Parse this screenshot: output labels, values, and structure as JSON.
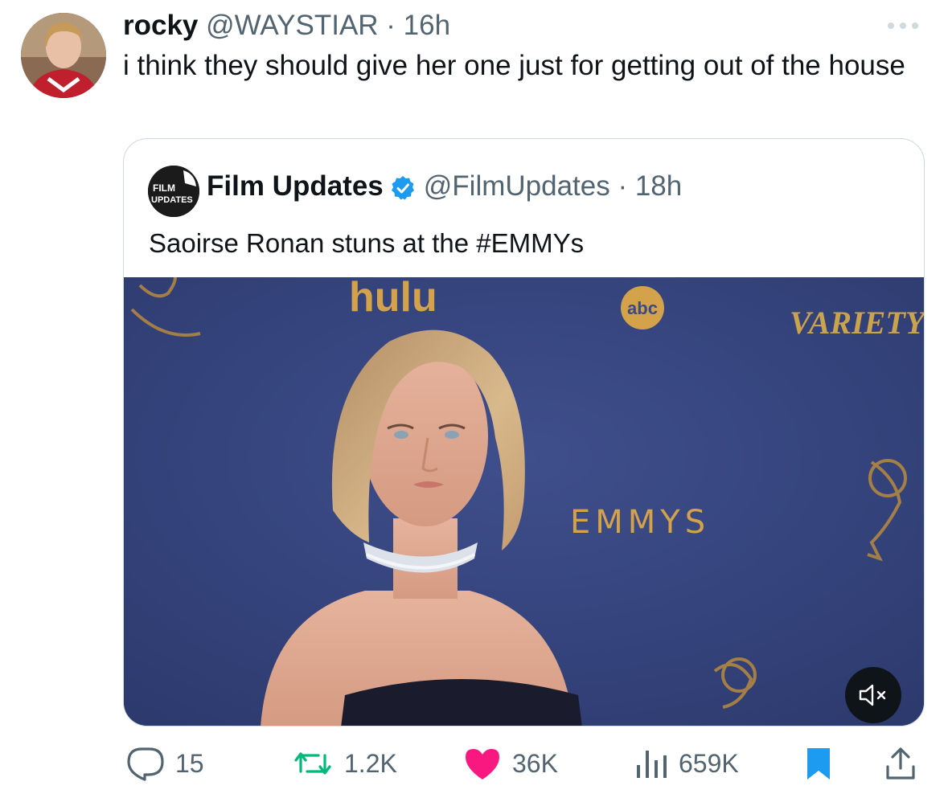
{
  "tweet": {
    "display_name": "rocky",
    "handle_time": "@WAYSTIAR · 16h",
    "text": "i think they should give her one just for getting out of the house"
  },
  "quoted": {
    "display_name": "Film Updates",
    "handle_time": "@FilmUpdates · 18h",
    "avatar_text": "FILM UPDATES",
    "text": "Saoirse Ronan stuns at the #EMMYs",
    "media": {
      "logos": [
        "hulu",
        "abc",
        "VARIETY",
        "EMMYS"
      ]
    }
  },
  "actions": {
    "replies": "15",
    "reposts": "1.2K",
    "likes": "36K",
    "views": "659K"
  },
  "colors": {
    "like": "#f91880",
    "repost": "#00ba7c",
    "bookmark": "#1d9bf0",
    "verified": "#1d9bf0",
    "text": "#0f1419",
    "meta": "#536471"
  },
  "icons": [
    "more-icon",
    "verified-icon",
    "mute-icon",
    "reply-icon",
    "repost-icon",
    "like-icon",
    "views-icon",
    "bookmark-icon",
    "share-icon"
  ]
}
